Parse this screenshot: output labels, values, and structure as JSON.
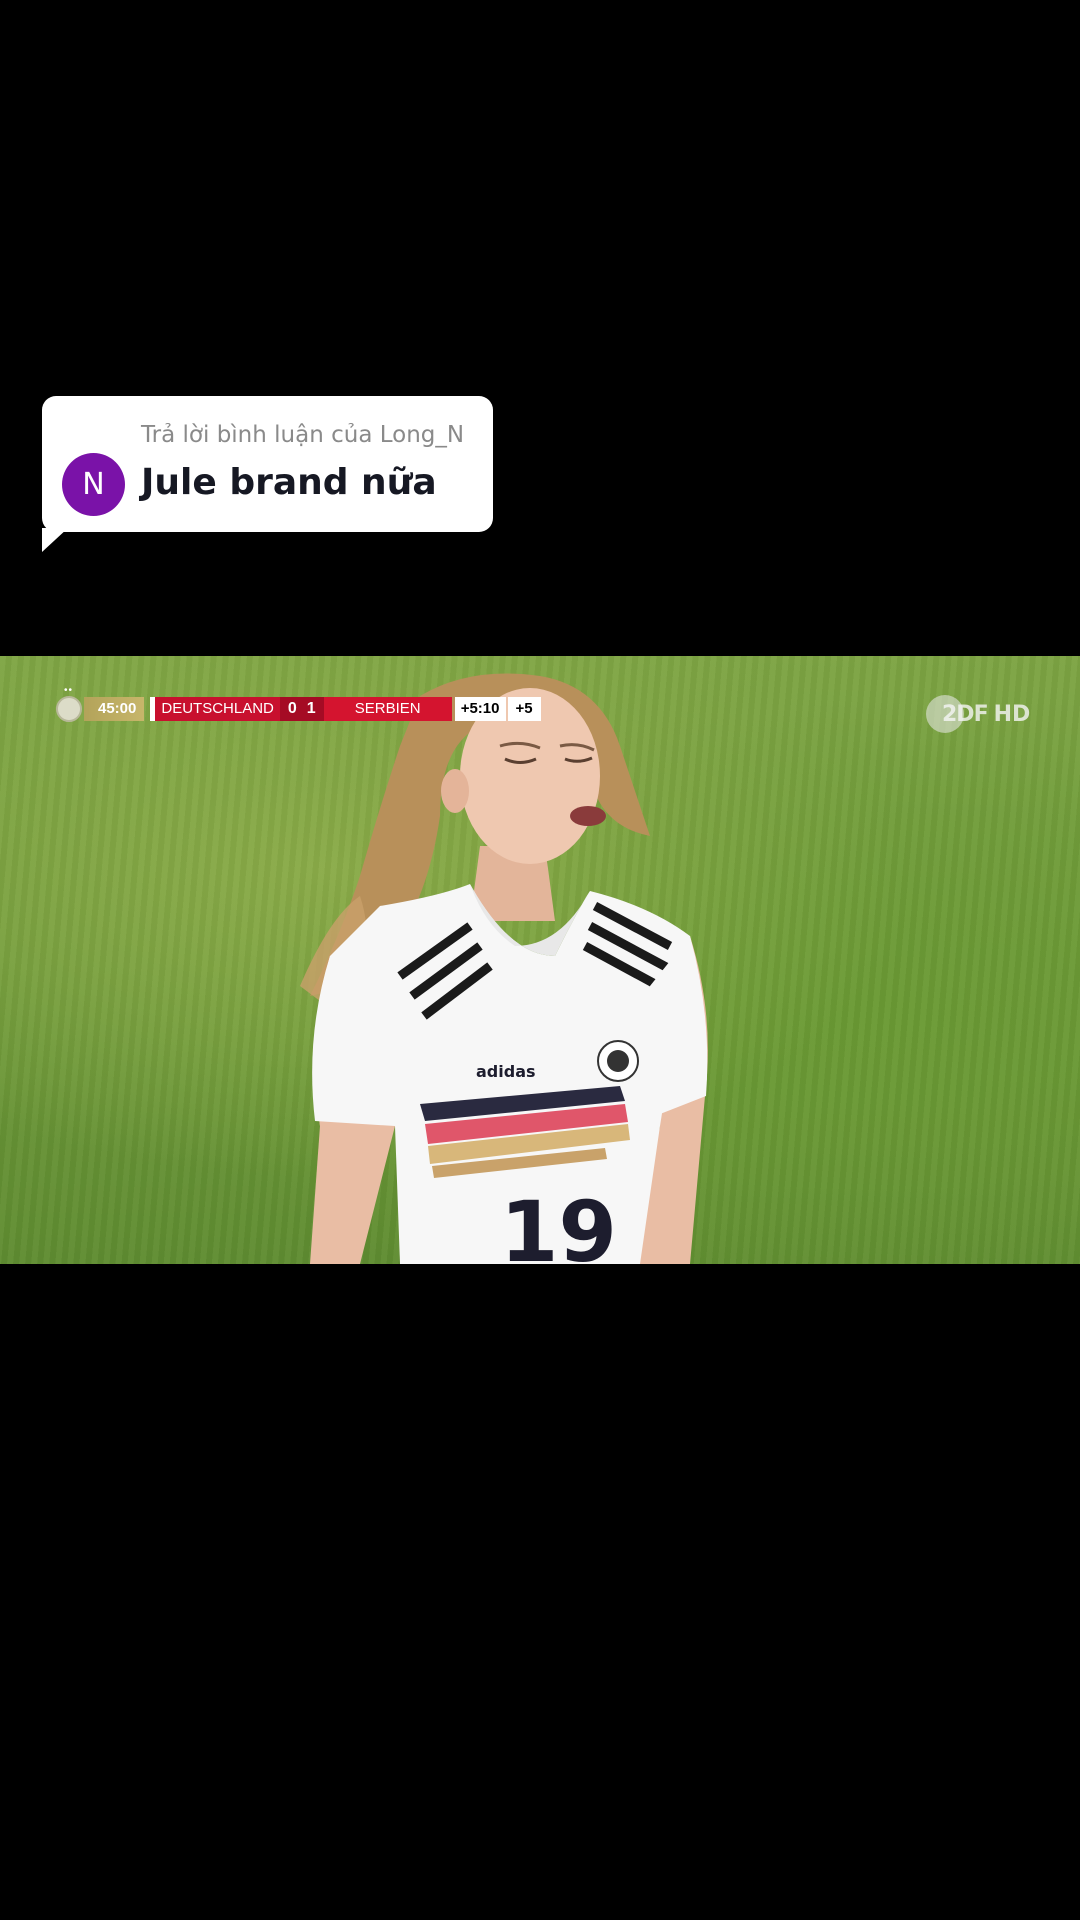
{
  "reply": {
    "avatar_letter": "N",
    "header": "Trả lời bình luận của Long_N",
    "text": "Jule brand nữa",
    "avatar_color": "#7a12a8"
  },
  "scoreboard": {
    "time": "45:00",
    "home_team": "DEUTSCHLAND",
    "home_score": "0",
    "away_score": "1",
    "away_team": "SERBIEN",
    "added_time": "+5:10",
    "added_minutes": "+5",
    "home_color": "#c8102e"
  },
  "broadcaster": {
    "logo": "2DF",
    "quality": "HD"
  },
  "player": {
    "shirt_number": "19",
    "brand": "adidas"
  }
}
